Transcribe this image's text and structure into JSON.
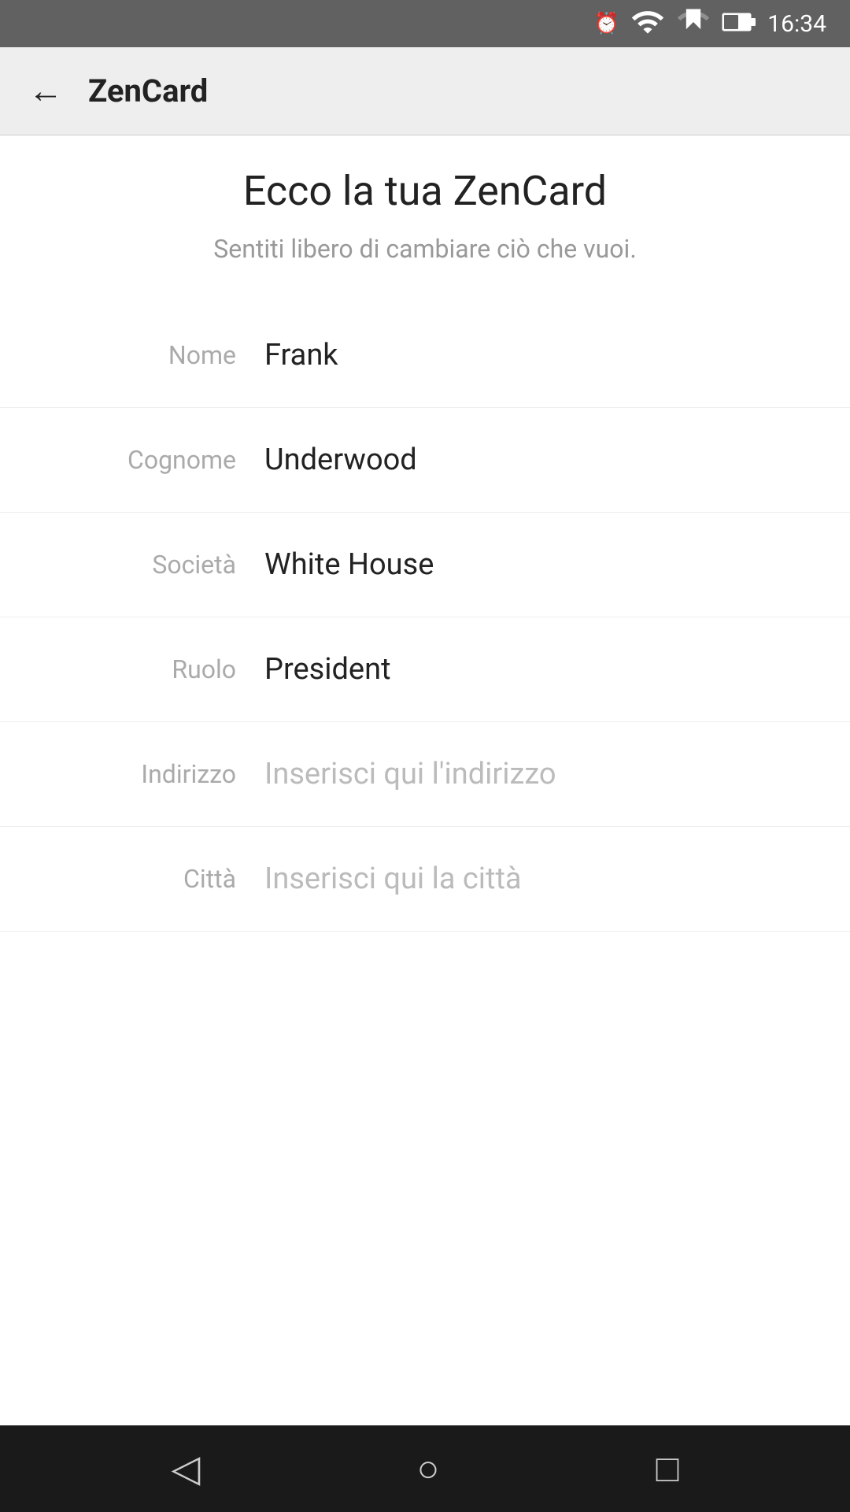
{
  "statusBar": {
    "time": "16:34"
  },
  "appBar": {
    "title": "ZenCard",
    "backLabel": "←"
  },
  "page": {
    "heading": "Ecco la tua ZenCard",
    "subtitle": "Sentiti libero di cambiare ciò che vuoi."
  },
  "fields": [
    {
      "label": "Nome",
      "value": "Frank",
      "placeholder": false,
      "id": "nome"
    },
    {
      "label": "Cognome",
      "value": "Underwood",
      "placeholder": false,
      "id": "cognome"
    },
    {
      "label": "Società",
      "value": "White House",
      "placeholder": false,
      "id": "societa"
    },
    {
      "label": "Ruolo",
      "value": "President",
      "placeholder": false,
      "id": "ruolo"
    },
    {
      "label": "Indirizzo",
      "value": "Inserisci qui l'indirizzo",
      "placeholder": true,
      "id": "indirizzo"
    },
    {
      "label": "Città",
      "value": "Inserisci qui la città",
      "placeholder": true,
      "id": "citta"
    }
  ],
  "navBar": {
    "backLabel": "◁",
    "homeLabel": "○",
    "recentLabel": "□"
  }
}
